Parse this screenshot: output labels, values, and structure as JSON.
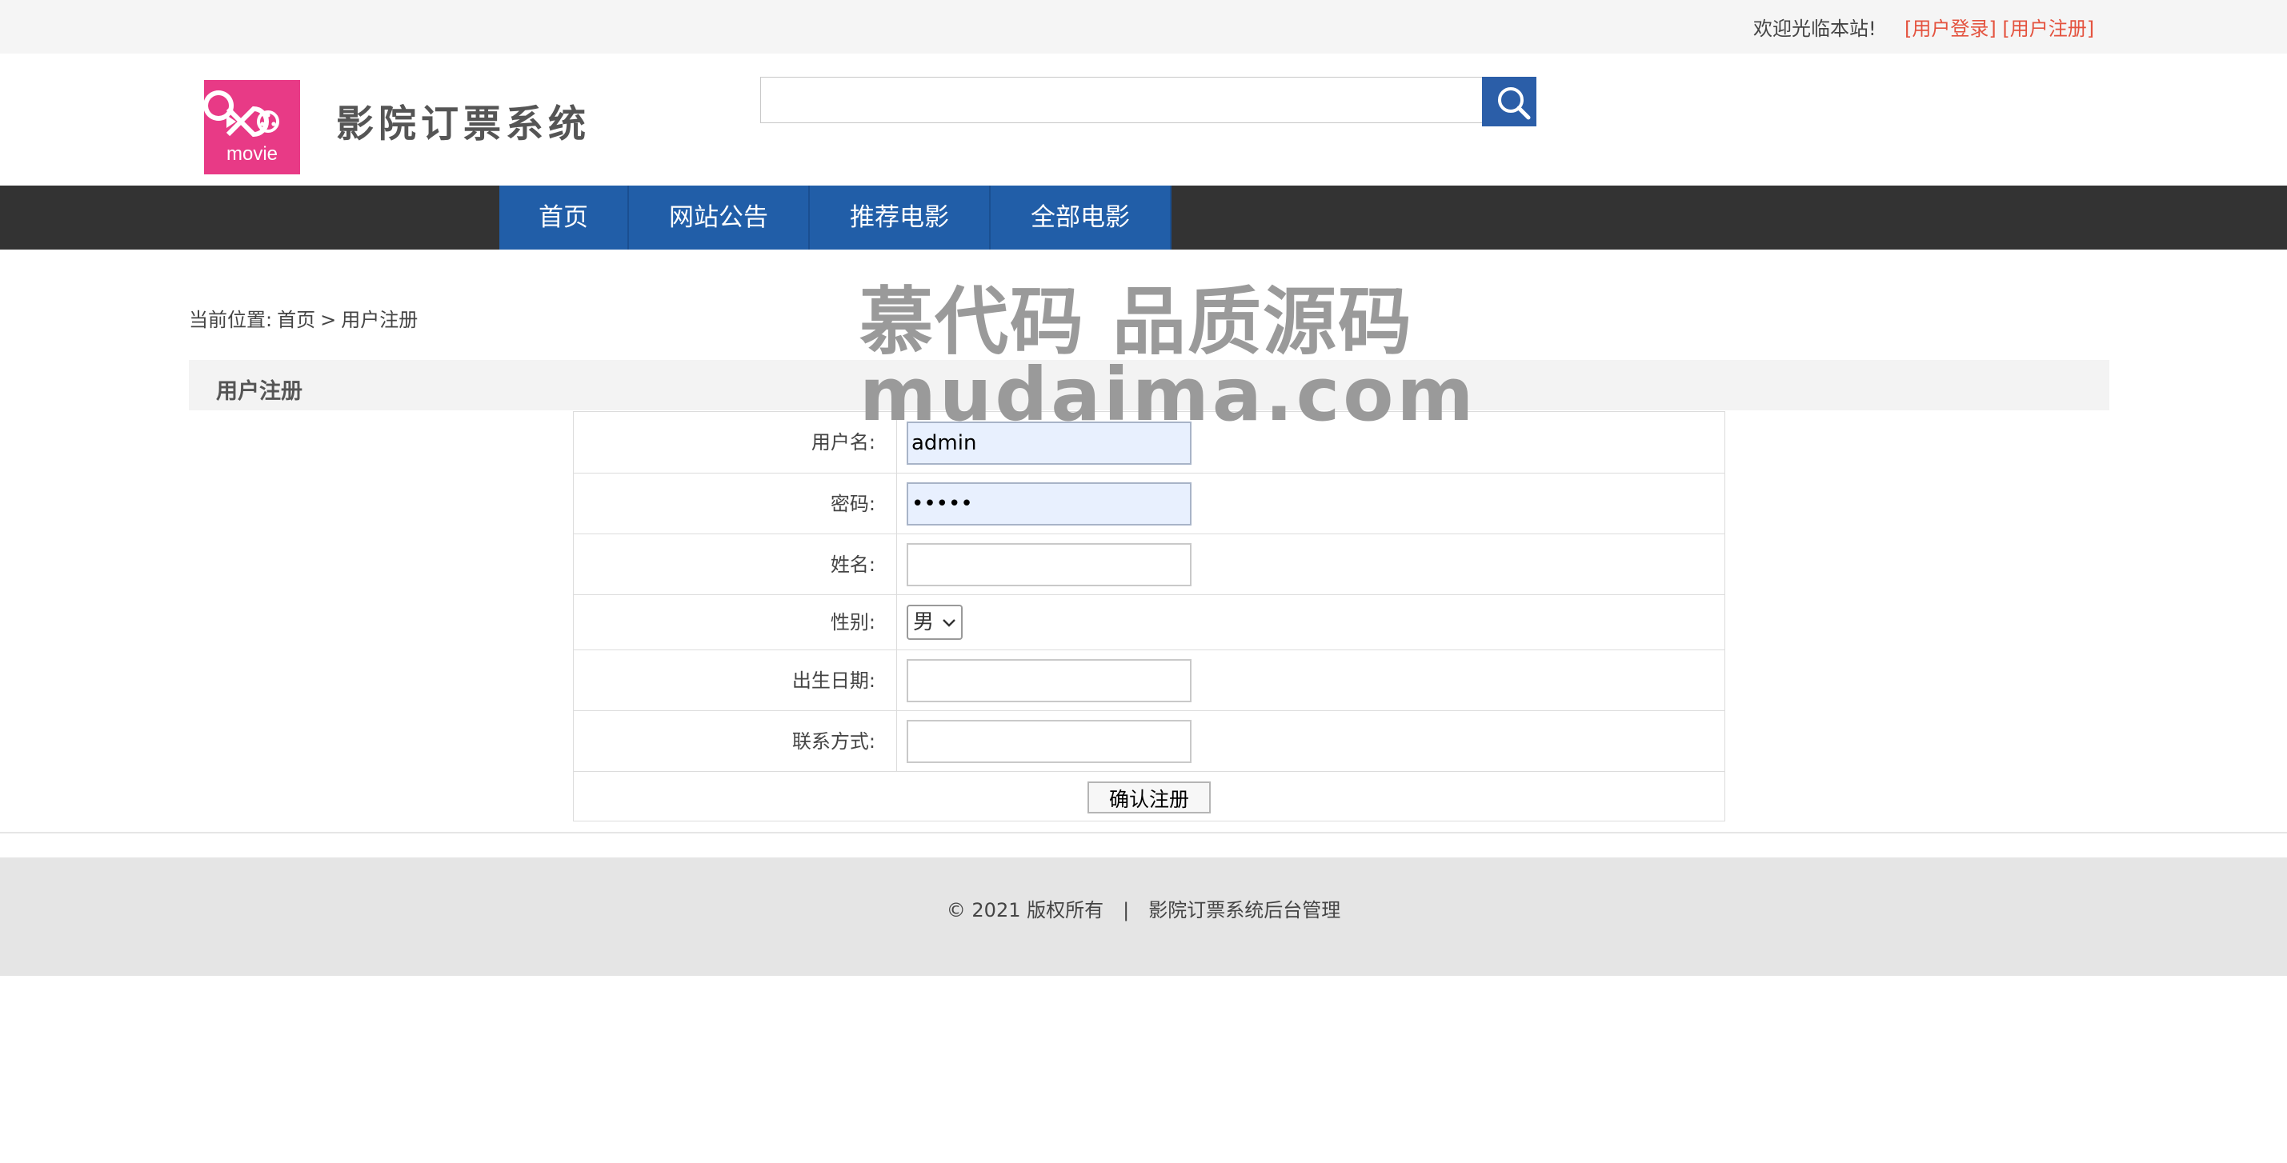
{
  "topbar": {
    "welcome": "欢迎光临本站!",
    "login": "[用户登录]",
    "register": "[用户注册]"
  },
  "header": {
    "logo_text": "movie",
    "brand": "影院订票系统",
    "search_placeholder": ""
  },
  "nav": {
    "items": [
      {
        "label": "首页"
      },
      {
        "label": "网站公告"
      },
      {
        "label": "推荐电影"
      },
      {
        "label": "全部电影"
      }
    ]
  },
  "breadcrumb": {
    "prefix": "当前位置:",
    "home": "首页",
    "separator": ">",
    "current": "用户注册"
  },
  "section": {
    "title": "用户注册"
  },
  "form": {
    "username_label": "用户名:",
    "username_value": "admin",
    "password_label": "密码:",
    "password_value": "•••••",
    "name_label": "姓名:",
    "name_value": "",
    "gender_label": "性别:",
    "gender_value": "男",
    "birth_label": "出生日期:",
    "birth_value": "",
    "contact_label": "联系方式:",
    "contact_value": "",
    "submit_label": "确认注册"
  },
  "watermark": {
    "line1": "慕代码 品质源码",
    "line2": "mudaima.com"
  },
  "footer": {
    "copyright": "© 2021 版权所有",
    "separator": "|",
    "admin_link": "影院订票系统后台管理"
  },
  "colors": {
    "brand_pink": "#e83a86",
    "nav_blue": "#215ea8",
    "nav_bar": "#333333",
    "link_red": "#e4533f"
  }
}
